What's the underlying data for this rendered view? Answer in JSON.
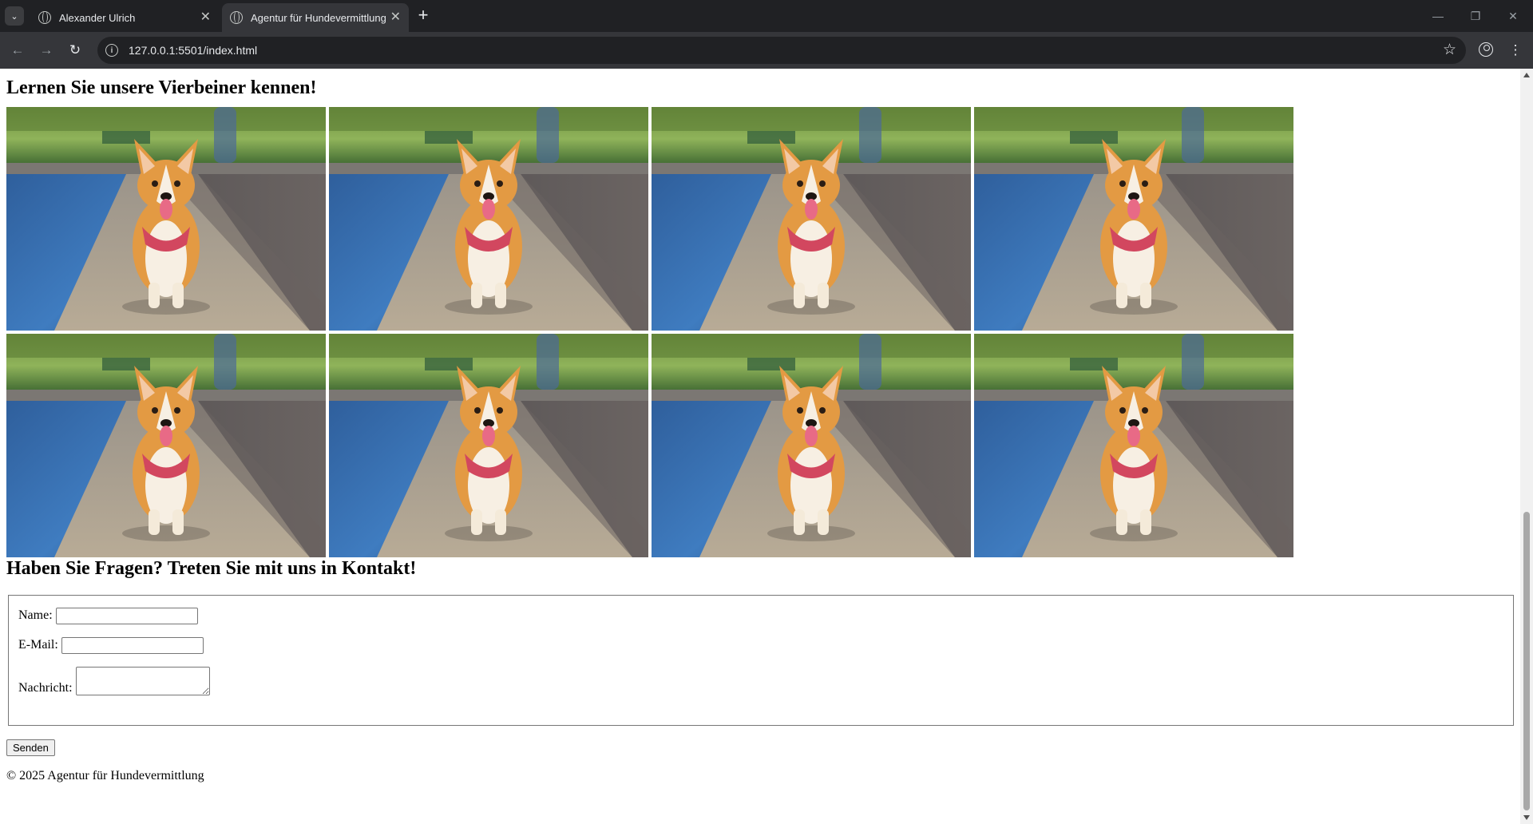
{
  "browser": {
    "tabs": [
      {
        "title": "Alexander Ulrich",
        "active": false
      },
      {
        "title": "Agentur für Hundevermittlung",
        "active": true
      }
    ],
    "url": "127.0.0.1:5501/index.html"
  },
  "page": {
    "gallery_heading": "Lernen Sie unsere Vierbeiner kennen!",
    "gallery_count": 8,
    "contact_heading": "Haben Sie Fragen? Treten Sie mit uns in Kontakt!",
    "form": {
      "name_label": "Name:",
      "name_value": "",
      "email_label": "E-Mail:",
      "email_value": "",
      "message_label": "Nachricht:",
      "message_value": "",
      "submit_label": "Senden"
    },
    "footer": "© 2025 Agentur für Hundevermittlung"
  },
  "colors": {
    "chrome_dark": "#202124",
    "chrome_toolbar": "#35363a",
    "page_bg": "#ffffff"
  }
}
